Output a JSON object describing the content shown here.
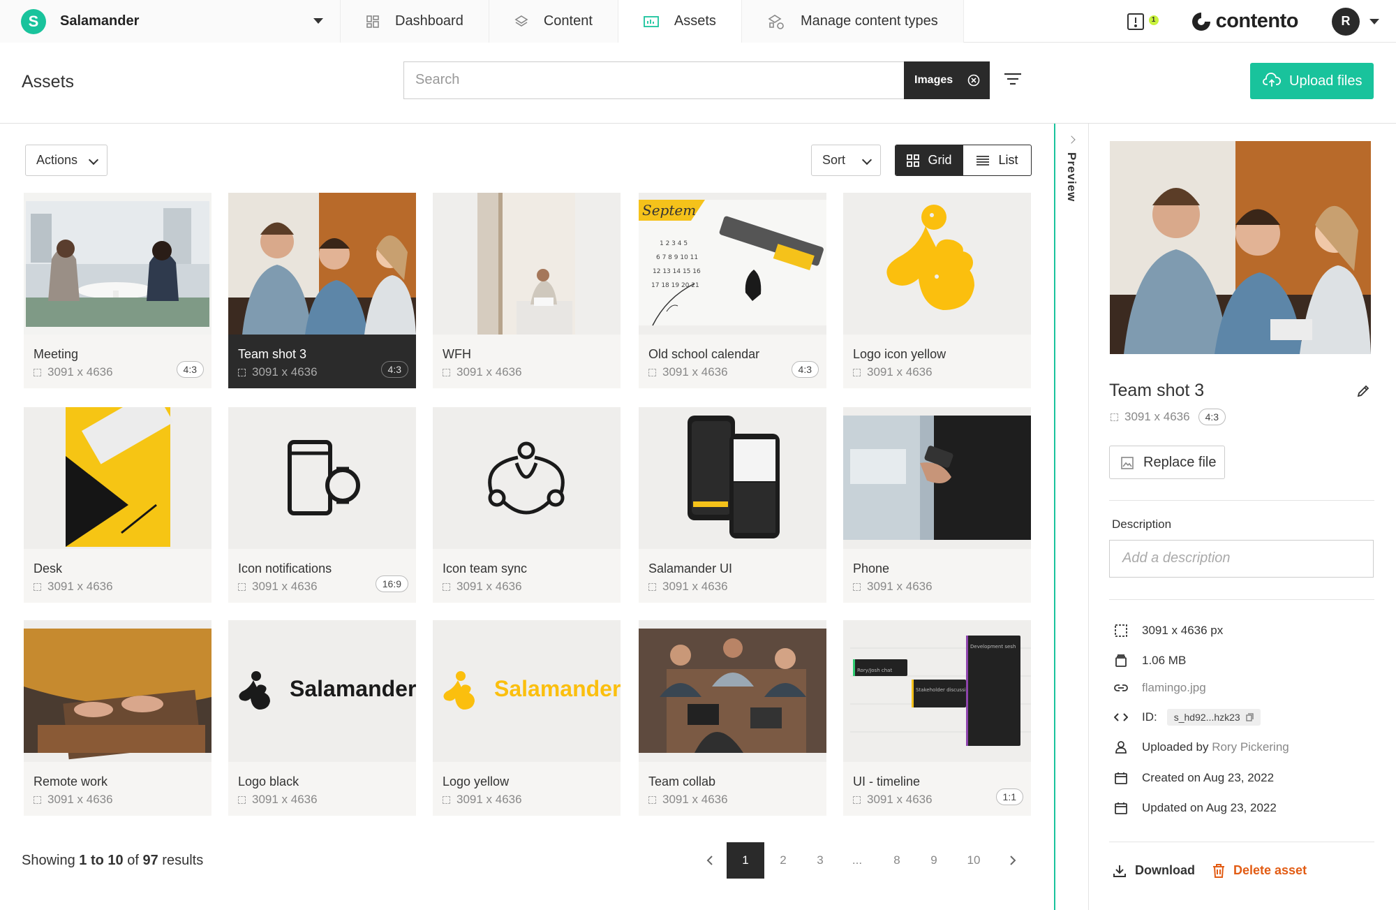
{
  "topbar": {
    "workspace": "Salamander",
    "workspace_initial": "S",
    "tabs": [
      {
        "label": "Dashboard",
        "icon": "dashboard-icon"
      },
      {
        "label": "Content",
        "icon": "layers-icon"
      },
      {
        "label": "Assets",
        "icon": "assets-icon",
        "active": true
      },
      {
        "label": "Manage content types",
        "icon": "shapes-icon"
      }
    ],
    "notification_count": "1",
    "product_name": "contento",
    "user_initial": "R"
  },
  "header": {
    "title": "Assets",
    "search_placeholder": "Search",
    "filter_chip": "Images",
    "upload_label": "Upload files"
  },
  "toolbar": {
    "actions_label": "Actions",
    "sort_label": "Sort",
    "grid_label": "Grid",
    "list_label": "List"
  },
  "assets": [
    {
      "title": "Meeting",
      "dims": "3091 x 4636",
      "ratio": "4:3"
    },
    {
      "title": "Team shot 3",
      "dims": "3091 x 4636",
      "ratio": "4:3",
      "selected": true
    },
    {
      "title": "WFH",
      "dims": "3091 x 4636",
      "ratio": ""
    },
    {
      "title": "Old school calendar",
      "dims": "3091 x 4636",
      "ratio": "4:3"
    },
    {
      "title": "Logo icon yellow",
      "dims": "3091 x 4636",
      "ratio": ""
    },
    {
      "title": "Desk",
      "dims": "3091 x 4636",
      "ratio": ""
    },
    {
      "title": "Icon notifications",
      "dims": "3091 x 4636",
      "ratio": "16:9"
    },
    {
      "title": "Icon team sync",
      "dims": "3091 x 4636",
      "ratio": ""
    },
    {
      "title": "Salamander UI",
      "dims": "3091 x 4636",
      "ratio": ""
    },
    {
      "title": "Phone",
      "dims": "3091 x 4636",
      "ratio": ""
    },
    {
      "title": "Remote work",
      "dims": "3091 x 4636",
      "ratio": ""
    },
    {
      "title": "Logo black",
      "dims": "3091 x 4636",
      "ratio": ""
    },
    {
      "title": "Logo yellow",
      "dims": "3091 x 4636",
      "ratio": ""
    },
    {
      "title": "Team collab",
      "dims": "3091 x 4636",
      "ratio": ""
    },
    {
      "title": "UI - timeline",
      "dims": "3091 x 4636",
      "ratio": "1:1"
    }
  ],
  "thumb_text": {
    "logo_word": "Salamander",
    "calendar_word": "Septem",
    "timeline_chat": "Rory/Josh chat",
    "timeline_stakeholder": "Stakeholder discussion",
    "timeline_dev": "Development sesh"
  },
  "pagination": {
    "showing_prefix": "Showing",
    "range_from": "1",
    "range_to_word": "to",
    "range_to": "10",
    "of_word": "of",
    "total": "97",
    "suffix": "results",
    "pages": [
      "1",
      "2",
      "3",
      "...",
      "8",
      "9",
      "10"
    ],
    "current": "1"
  },
  "preview": {
    "label": "Preview",
    "title": "Team shot 3",
    "dims": "3091 x 4636",
    "ratio": "4:3",
    "replace_label": "Replace file",
    "description_label": "Description",
    "description_placeholder": "Add a description",
    "size_px": "3091 x 4636 px",
    "file_size": "1.06 MB",
    "filename": "flamingo.jpg",
    "id_label": "ID:",
    "id_value": "s_hd92...hzk23",
    "uploaded_by_label": "Uploaded by",
    "uploaded_by": "Rory Pickering",
    "created": "Created on Aug 23, 2022",
    "updated": "Updated on Aug 23, 2022",
    "download_label": "Download",
    "delete_label": "Delete asset"
  },
  "colors": {
    "accent": "#19c39c",
    "dark": "#2a2a2a",
    "danger": "#e25c14",
    "yellow": "#fbbf0e"
  }
}
